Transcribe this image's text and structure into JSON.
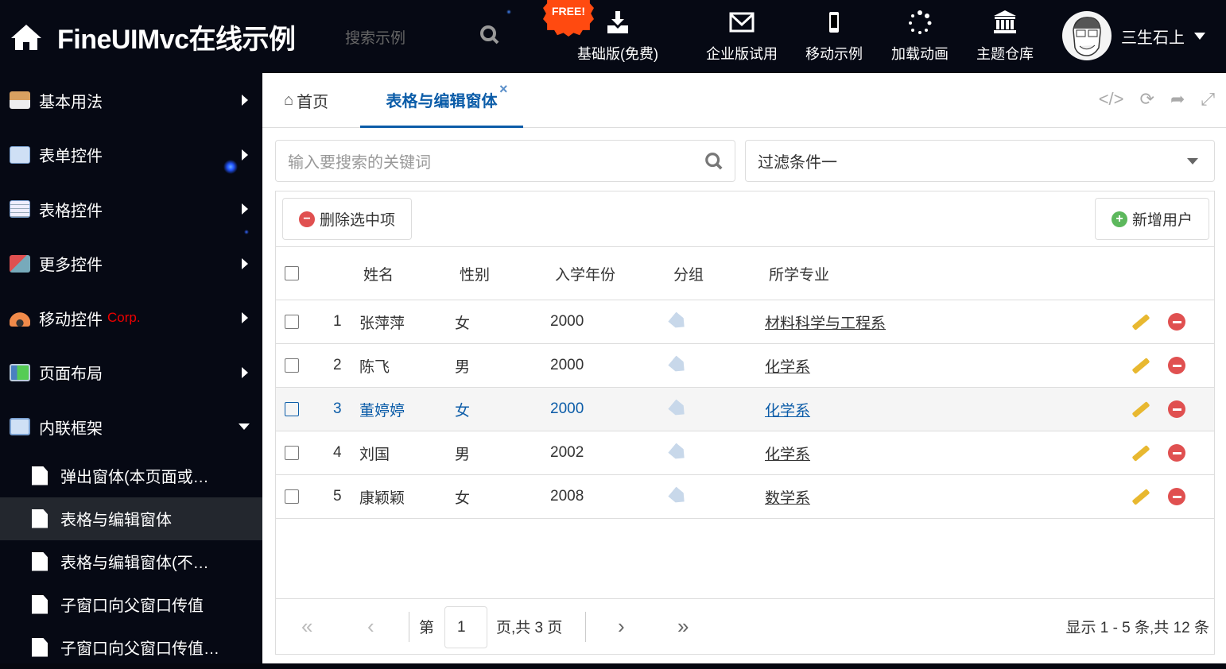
{
  "header": {
    "title": "FineUIMvc在线示例",
    "search_placeholder": "搜索示例",
    "free_badge": "FREE!",
    "nav": [
      {
        "label": "基础版(免费)",
        "icon": "download-icon"
      },
      {
        "label": "企业版试用",
        "icon": "envelope-icon"
      },
      {
        "label": "移动示例",
        "icon": "mobile-icon"
      },
      {
        "label": "加载动画",
        "icon": "spinner-icon"
      },
      {
        "label": "主题仓库",
        "icon": "bank-icon"
      }
    ],
    "user": "三生石上"
  },
  "sidebar": {
    "items": [
      {
        "label": "基本用法"
      },
      {
        "label": "表单控件"
      },
      {
        "label": "表格控件"
      },
      {
        "label": "更多控件"
      },
      {
        "label": "移动控件",
        "badge": "Corp."
      },
      {
        "label": "页面布局"
      },
      {
        "label": "内联框架"
      }
    ],
    "subitems": [
      "弹出窗体(本页面或…",
      "表格与编辑窗体",
      "表格与编辑窗体(不…",
      "子窗口向父窗口传值",
      "子窗口向父窗口传值…"
    ]
  },
  "tabs": {
    "home": "首页",
    "active": "表格与编辑窗体",
    "close": "×"
  },
  "filters": {
    "search_placeholder": "输入要搜索的关键词",
    "dropdown": "过滤条件一"
  },
  "toolbar": {
    "delete": "删除选中项",
    "add": "新增用户"
  },
  "grid": {
    "columns": [
      "姓名",
      "性别",
      "入学年份",
      "分组",
      "所学专业"
    ],
    "rows": [
      {
        "n": "1",
        "name": "张萍萍",
        "gender": "女",
        "year": "2000",
        "major": "材料科学与工程系"
      },
      {
        "n": "2",
        "name": "陈飞",
        "gender": "男",
        "year": "2000",
        "major": "化学系"
      },
      {
        "n": "3",
        "name": "董婷婷",
        "gender": "女",
        "year": "2000",
        "major": "化学系"
      },
      {
        "n": "4",
        "name": "刘国",
        "gender": "男",
        "year": "2002",
        "major": "化学系"
      },
      {
        "n": "5",
        "name": "康颖颖",
        "gender": "女",
        "year": "2008",
        "major": "数学系"
      }
    ]
  },
  "pager": {
    "page_prefix": "第",
    "page": "1",
    "page_suffix": "页,共 3 页",
    "summary": "显示 1 - 5 条,共 12 条"
  },
  "colors": {
    "accent": "#0b5ca8",
    "danger": "#e05050"
  }
}
